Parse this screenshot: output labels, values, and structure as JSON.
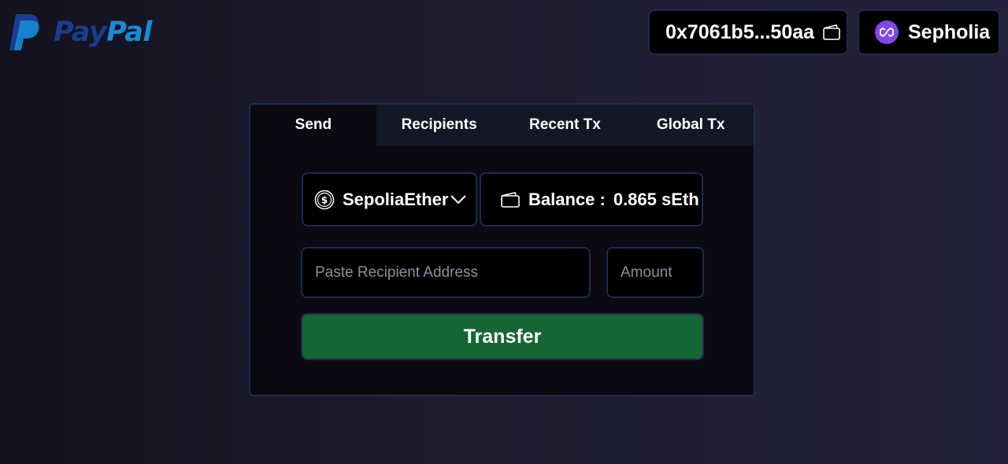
{
  "brand": {
    "pay": "Pay",
    "pal": "Pal",
    "colors": {
      "pay": "#1b3d8f",
      "pal": "#1a8ad6"
    }
  },
  "header": {
    "wallet_address": "0x7061b5...50aa",
    "network": "Sepholia",
    "network_color": "#8247e5"
  },
  "tabs": [
    {
      "label": "Send",
      "active": true
    },
    {
      "label": "Recipients",
      "active": false
    },
    {
      "label": "Recent Tx",
      "active": false
    },
    {
      "label": "Global Tx",
      "active": false
    }
  ],
  "send": {
    "token": "SepoliaEther",
    "balance_label": "Balance :",
    "balance_value": "0.865 sEth",
    "address_placeholder": "Paste Recipient Address",
    "amount_placeholder": "Amount",
    "transfer_label": "Transfer",
    "transfer_color": "#166534"
  },
  "icons": [
    "paypal-logo-icon",
    "wallet-icon",
    "polygon-icon",
    "dollar-coin-icon",
    "chevron-down-icon"
  ]
}
